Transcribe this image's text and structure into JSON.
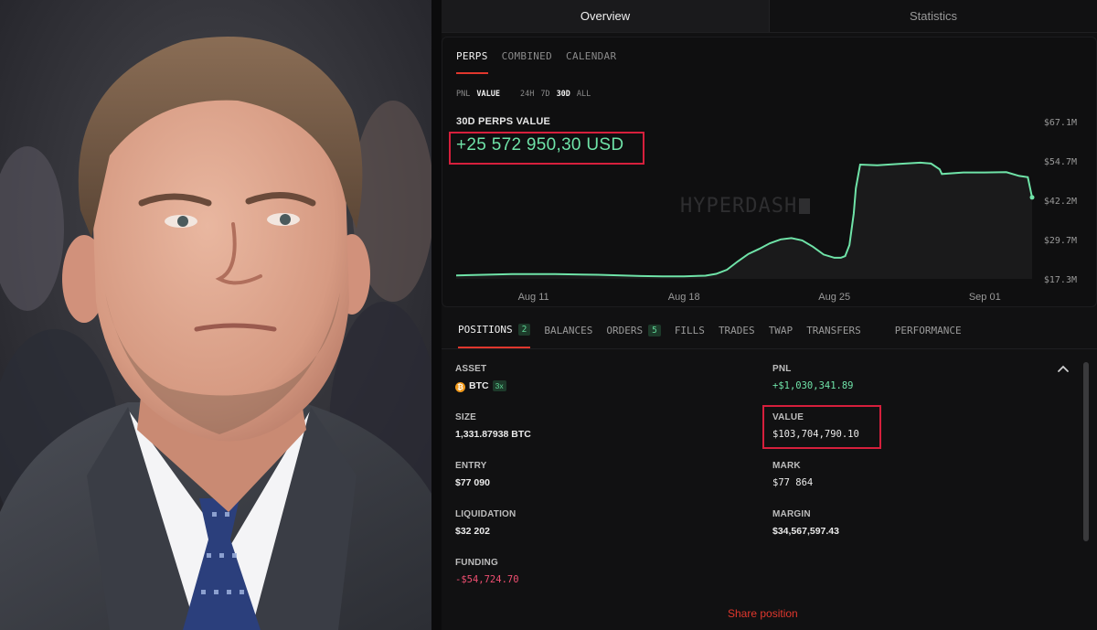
{
  "dashboard": {
    "top_tabs": [
      "Overview",
      "Statistics"
    ],
    "sub_tabs": [
      "PERPS",
      "COMBINED",
      "CALENDAR"
    ],
    "metric_modes": [
      "PNL",
      "VALUE"
    ],
    "ranges": [
      "24H",
      "7D",
      "30D",
      "ALL"
    ],
    "metric_label": "30D PERPS VALUE",
    "metric_value": "+25 572 950,30 USD",
    "watermark": "HYPERDASH"
  },
  "chart_data": {
    "type": "area",
    "title": "",
    "xlabel": "",
    "ylabel": "",
    "ylim": [
      17.3,
      67.1
    ],
    "y_ticks": [
      "$67.1M",
      "$54.7M",
      "$42.2M",
      "$29.7M",
      "$17.3M"
    ],
    "x_ticks": [
      "Aug 11",
      "Aug 18",
      "Aug 25",
      "Sep 01"
    ],
    "x_tick_pos": [
      9,
      16,
      23,
      30
    ],
    "x": [
      5.4,
      6,
      8,
      10,
      12,
      14,
      15,
      16,
      17,
      17.5,
      18,
      18.5,
      19,
      19.5,
      20,
      20.5,
      21,
      21.5,
      22,
      22.5,
      23,
      23.3,
      23.5,
      23.7,
      23.9,
      24.0,
      24.2,
      25,
      26,
      27,
      27.5,
      27.9,
      28,
      29,
      30,
      31,
      31.6,
      32,
      32.2
    ],
    "values": [
      18.4,
      18.5,
      18.8,
      18.8,
      18.6,
      18.2,
      18.1,
      18.1,
      18.3,
      18.9,
      20.2,
      22.8,
      25.2,
      26.8,
      28.6,
      29.8,
      30.2,
      29.5,
      27.5,
      25.0,
      24.0,
      24.0,
      24.5,
      28.0,
      38.0,
      46.0,
      53.5,
      53.3,
      53.7,
      54.1,
      53.8,
      52.0,
      50.5,
      51.0,
      51.0,
      51.1,
      49.9,
      49.5,
      43.1
    ],
    "line_color": "#6fe3a8",
    "fill_color": "#1a1a1b",
    "grid": false
  },
  "positions": {
    "tabs": [
      {
        "label": "POSITIONS",
        "badge": "2"
      },
      {
        "label": "BALANCES",
        "badge": ""
      },
      {
        "label": "ORDERS",
        "badge": "5"
      },
      {
        "label": "FILLS",
        "badge": ""
      },
      {
        "label": "TRADES",
        "badge": ""
      },
      {
        "label": "TWAP",
        "badge": ""
      },
      {
        "label": "TRANSFERS",
        "badge": ""
      },
      {
        "label": "PERFORMANCE",
        "badge": ""
      }
    ],
    "asset_label": "ASSET",
    "asset_coin_glyph": "₿",
    "asset": "BTC",
    "leverage": "3x",
    "pnl_label": "PNL",
    "pnl": "+$1,030,341.89",
    "size_label": "SIZE",
    "size": "1,331.87938 BTC",
    "value_label": "VALUE",
    "value": "$103,704,790.10",
    "entry_label": "ENTRY",
    "entry": "$77 090",
    "mark_label": "MARK",
    "mark": "$77 864",
    "liq_label": "LIQUIDATION",
    "liquidation": "$32 202",
    "margin_label": "MARGIN",
    "margin": "$34,567,597.43",
    "funding_label": "FUNDING",
    "funding": "-$54,724.70",
    "share": "Share position"
  },
  "colors": {
    "accent_red": "#e0372d",
    "highlight_box": "#d61f3c",
    "positive": "#6fe3a8",
    "negative": "#ef4f71"
  }
}
